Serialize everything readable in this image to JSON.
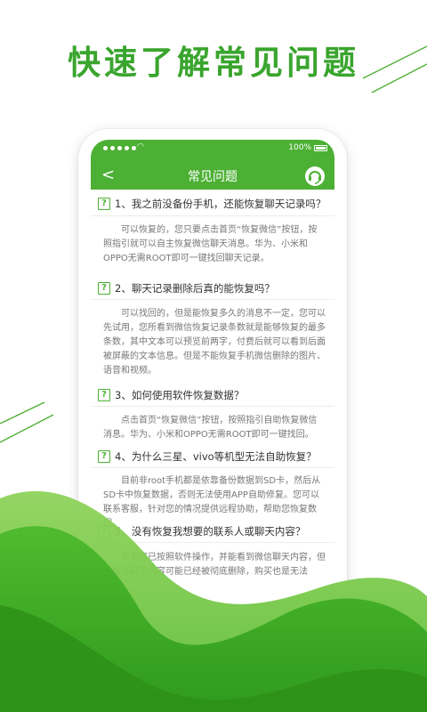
{
  "headline": "快速了解常见问题",
  "status": {
    "battery_text": "100%"
  },
  "nav": {
    "back": "<",
    "title": "常见问题"
  },
  "faqs": [
    {
      "qmark": "?",
      "question": "1、我之前没备份手机，还能恢复聊天记录吗？",
      "answer": "可以恢复的，您只要点击首页“恢复微信”按钮，按照指引就可以自主恢复微信聊天消息。华为、小米和OPPO无需ROOT即可一键找回聊天记录。"
    },
    {
      "qmark": "?",
      "question": "2、聊天记录删除后真的能恢复吗？",
      "answer": "可以找回的，但是能恢复多久的消息不一定，您可以先试用，您所看到微信恢复记录条数就是能够恢复的最多条数，其中文本可以预览前两字，付费后就可以看到后面被屏蔽的文本信息。但是不能恢复手机微信删除的图片、语音和视频。"
    },
    {
      "qmark": "?",
      "question": "3、如何使用软件恢复数据？",
      "answer": "点击首页“恢复微信”按钮，按照指引自助恢复微信消息。华为、小米和OPPO无需ROOT即可一键找回。"
    },
    {
      "qmark": "?",
      "question": "4、为什么三星、vivo等机型无法自助恢复？",
      "answer": "目前非root手机都是依靠备份数据到SD卡，然后从SD卡中恢复数据，否则无法使用APP自助修复。您可以联系客服，针对您的情况提供远程协助，帮助您恢复数据。"
    },
    {
      "qmark": "?",
      "question": "5、没有恢复我想要的联系人或聊天内容？",
      "answer": "如果您已按照软件操作，并能看到微信聊天内容，但可能是聊天内容可能已经被彻底删除，购买也是无法"
    }
  ],
  "colors": {
    "brand": "#4cb034",
    "headline": "#3aa52e"
  },
  "icons": {
    "service": "headset-icon",
    "back": "chevron-left-icon"
  }
}
